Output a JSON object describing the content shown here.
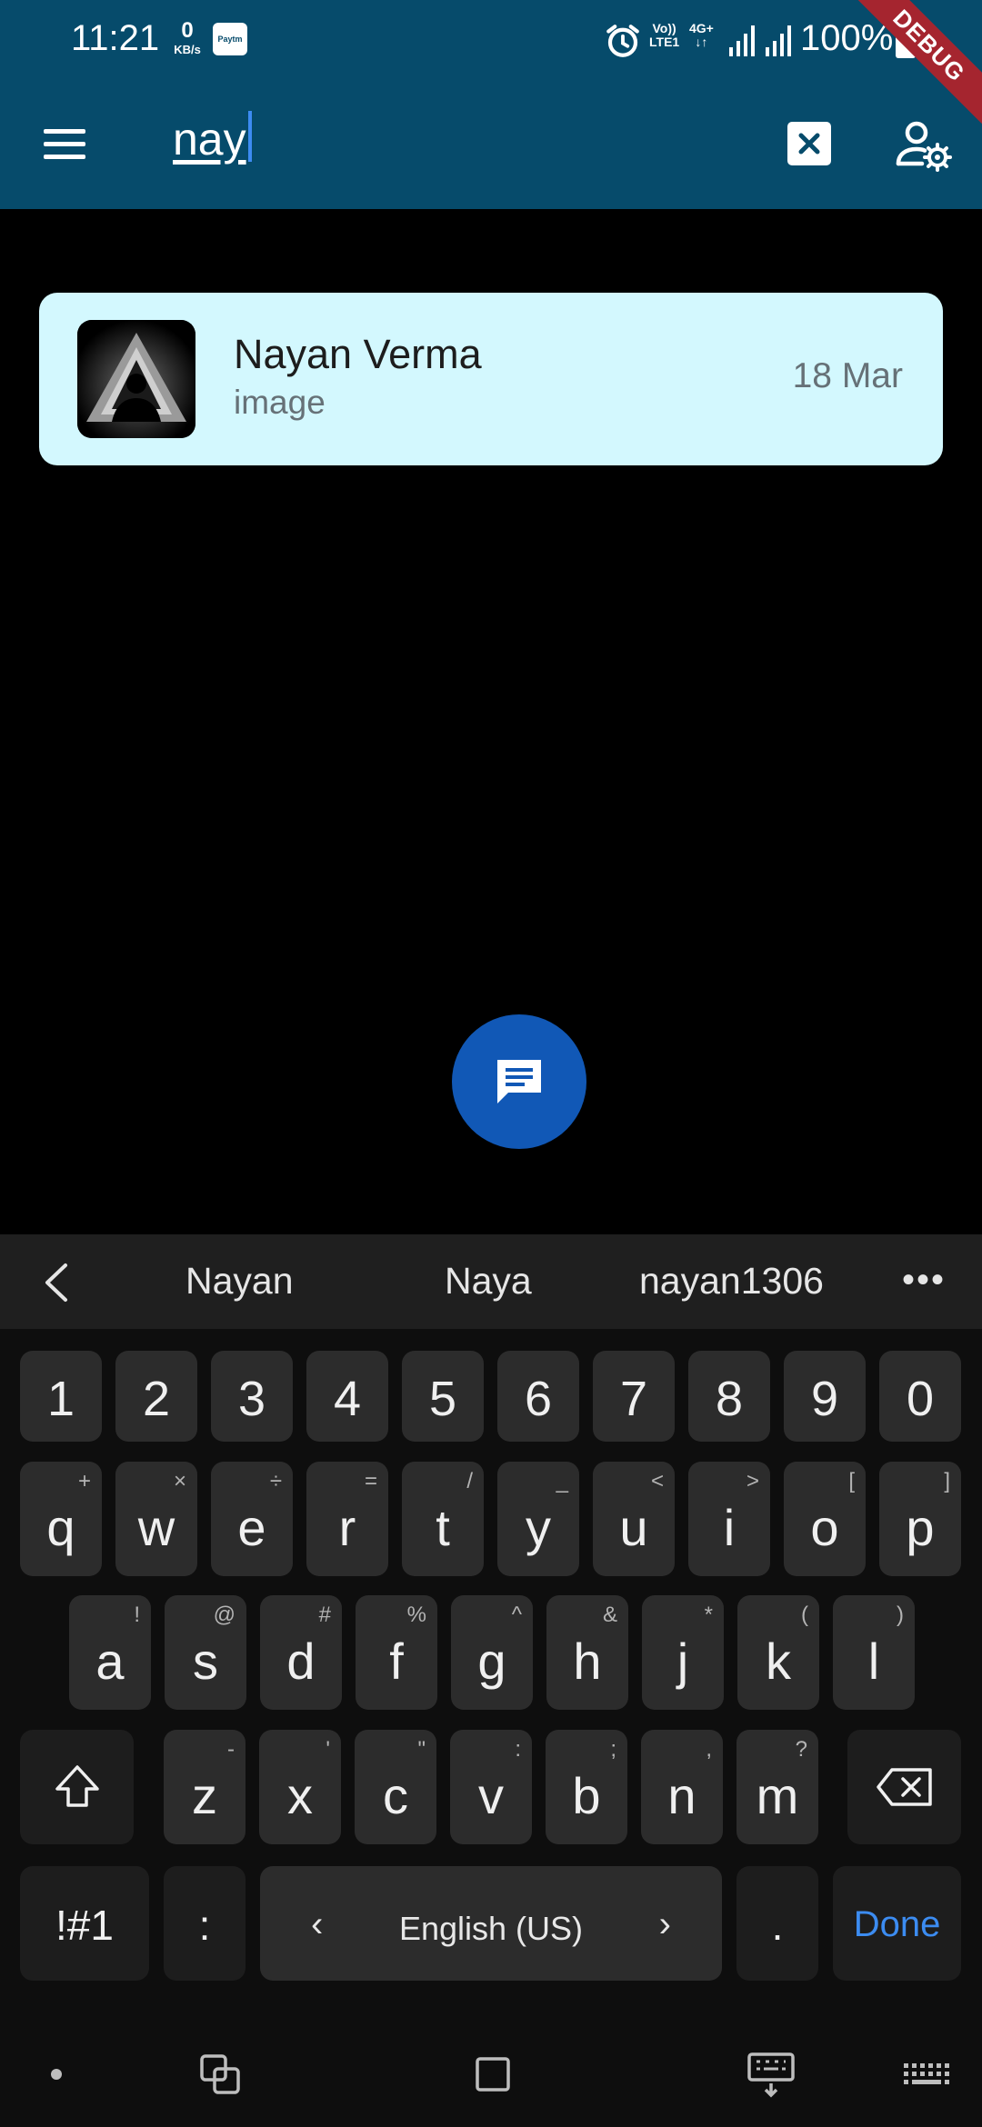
{
  "status_bar": {
    "time": "11:21",
    "data_rate_value": "0",
    "data_rate_unit": "KB/s",
    "paytm_label": "Paytm",
    "network_line1": "Vo))",
    "network_line2": "LTE1",
    "network_gen": "4G+",
    "battery_percent": "100%"
  },
  "debug_ribbon": "DEBUG",
  "app_bar": {
    "search_value": "nay"
  },
  "chats": [
    {
      "name": "Nayan Verma",
      "preview": "image",
      "date": "18 Mar"
    }
  ],
  "keyboard": {
    "suggestions": [
      "Nayan",
      "Naya",
      "nayan1306"
    ],
    "number_row": [
      "1",
      "2",
      "3",
      "4",
      "5",
      "6",
      "7",
      "8",
      "9",
      "0"
    ],
    "row1": [
      {
        "k": "q",
        "s": "+"
      },
      {
        "k": "w",
        "s": "×"
      },
      {
        "k": "e",
        "s": "÷"
      },
      {
        "k": "r",
        "s": "="
      },
      {
        "k": "t",
        "s": "/"
      },
      {
        "k": "y",
        "s": "_"
      },
      {
        "k": "u",
        "s": "<"
      },
      {
        "k": "i",
        "s": ">"
      },
      {
        "k": "o",
        "s": "["
      },
      {
        "k": "p",
        "s": "]"
      }
    ],
    "row2": [
      {
        "k": "a",
        "s": "!"
      },
      {
        "k": "s",
        "s": "@"
      },
      {
        "k": "d",
        "s": "#"
      },
      {
        "k": "f",
        "s": "%"
      },
      {
        "k": "g",
        "s": "^"
      },
      {
        "k": "h",
        "s": "&"
      },
      {
        "k": "j",
        "s": "*"
      },
      {
        "k": "k",
        "s": "("
      },
      {
        "k": "l",
        "s": ")"
      }
    ],
    "row3": [
      {
        "k": "z",
        "s": "-"
      },
      {
        "k": "x",
        "s": "'"
      },
      {
        "k": "c",
        "s": "\""
      },
      {
        "k": "v",
        "s": ":"
      },
      {
        "k": "b",
        "s": ";"
      },
      {
        "k": "n",
        "s": ","
      },
      {
        "k": "m",
        "s": "?"
      }
    ],
    "symbols_label": "!#1",
    "colon_label": ":",
    "space_label": "English (US)",
    "period_label": ".",
    "done_label": "Done"
  },
  "colors": {
    "app_bar": "#064b6b",
    "card": "#d3f8fe",
    "fab": "#1158b6",
    "done": "#3c8cf1"
  }
}
